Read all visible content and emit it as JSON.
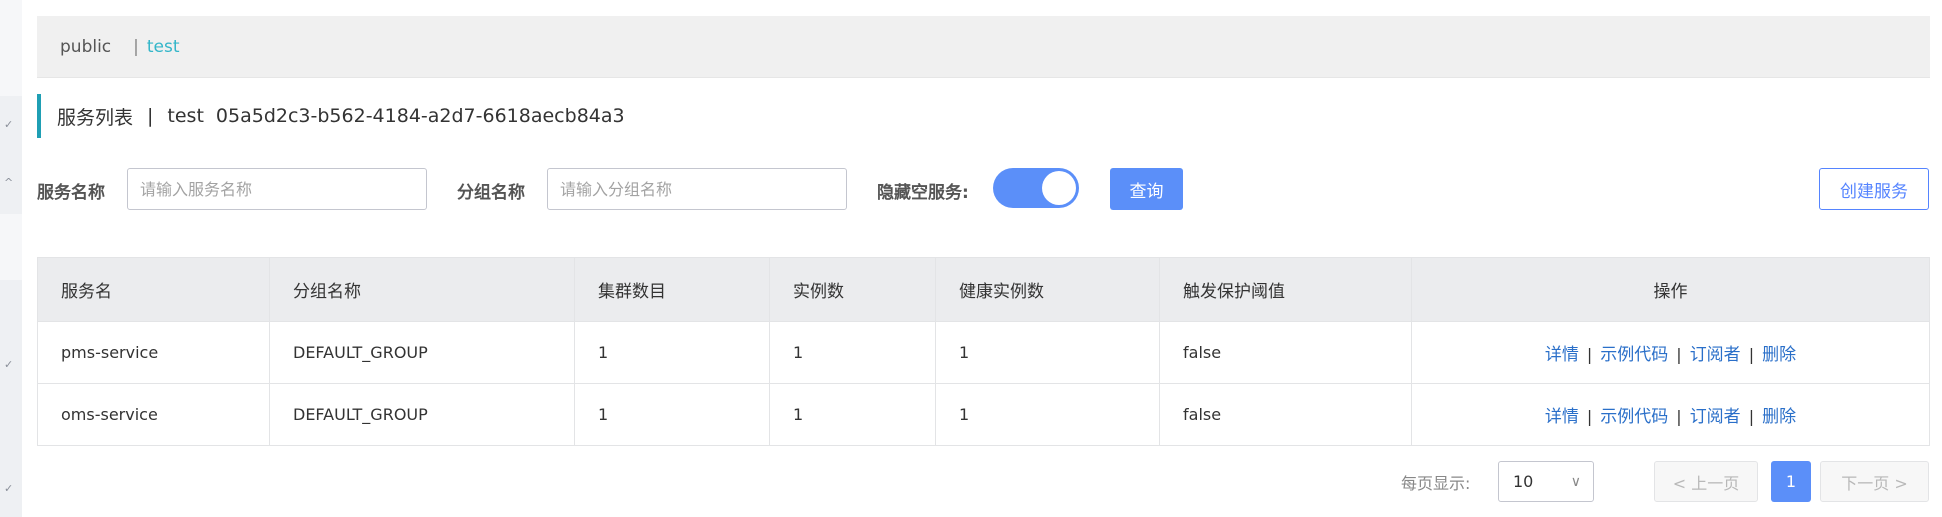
{
  "namespace_bar": {
    "public": "public",
    "separator": "|",
    "current": "test"
  },
  "title": {
    "label": "服务列表",
    "separator": "|",
    "namespace_name": "test",
    "namespace_id": "05a5d2c3-b562-4184-a2d7-6618aecb84a3"
  },
  "filters": {
    "service_name_label": "服务名称",
    "service_name_placeholder": "请输入服务名称",
    "group_name_label": "分组名称",
    "group_name_placeholder": "请输入分组名称",
    "hide_empty_label": "隐藏空服务:",
    "hide_empty_on": true,
    "query_label": "查询",
    "create_label": "创建服务"
  },
  "table": {
    "headers": [
      "服务名",
      "分组名称",
      "集群数目",
      "实例数",
      "健康实例数",
      "触发保护阈值",
      "操作"
    ],
    "rows": [
      {
        "name": "pms-service",
        "group": "DEFAULT_GROUP",
        "clusters": "1",
        "instances": "1",
        "healthy": "1",
        "threshold": "false"
      },
      {
        "name": "oms-service",
        "group": "DEFAULT_GROUP",
        "clusters": "1",
        "instances": "1",
        "healthy": "1",
        "threshold": "false"
      }
    ],
    "actions": {
      "detail": "详情",
      "sample_code": "示例代码",
      "subscribers": "订阅者",
      "delete": "删除",
      "separator": "|"
    }
  },
  "pagination": {
    "page_size_label": "每页显示:",
    "page_size": "10",
    "prev_label": "< 上一页",
    "current_page": "1",
    "next_label": "下一页 >"
  },
  "colors": {
    "primary": "#5b8ff9",
    "link": "#2a6fc9",
    "namespace_active": "#33b6c9",
    "title_accent": "#1f9fb4"
  }
}
